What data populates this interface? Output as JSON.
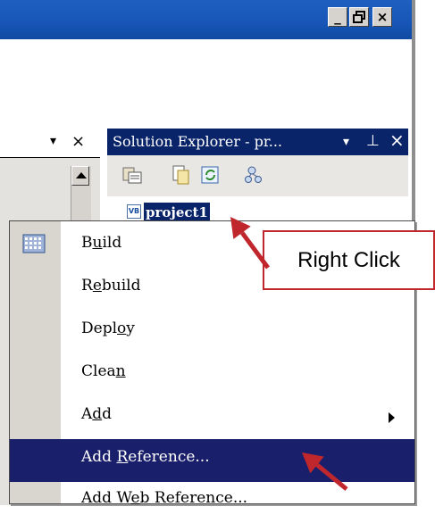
{
  "window": {
    "minimize_glyph": "_",
    "restore_glyph": "🗗",
    "close_glyph": "×"
  },
  "left_pane": {
    "dropdown_glyph": "▾",
    "close_glyph": "×"
  },
  "solution_explorer": {
    "title": "Solution Explorer - pr...",
    "dropdown_glyph": "▾",
    "pin_glyph": "⊥",
    "close_glyph": "×",
    "toolbar_icons": [
      "properties-icon",
      "show-all-files-icon",
      "refresh-icon",
      "view-class-diagram-icon"
    ],
    "project": {
      "icon": "vb-project-icon",
      "label": "project1"
    }
  },
  "context_menu": {
    "items": [
      {
        "label": "Build",
        "mnemonic_index": 1,
        "icon": "build-icon"
      },
      {
        "label": "Rebuild",
        "mnemonic_index": 1
      },
      {
        "label": "Deploy",
        "mnemonic_index": 4
      },
      {
        "label": "Clean",
        "mnemonic_index": 4
      },
      {
        "label": "Add",
        "mnemonic_index": 1,
        "has_submenu": true
      },
      {
        "label": "Add Reference...",
        "mnemonic_index": 4,
        "selected": true
      },
      {
        "label": "Add Web Reference...",
        "mnemonic_index": 5
      }
    ]
  },
  "annotation": {
    "callout_text": "Right Click",
    "arrow_color": "#c0272d"
  },
  "colors": {
    "title_bar": "#1756b6",
    "se_title": "#0a246a",
    "menu_highlight": "#1a1f6b",
    "annotation_red": "#c0272d"
  }
}
